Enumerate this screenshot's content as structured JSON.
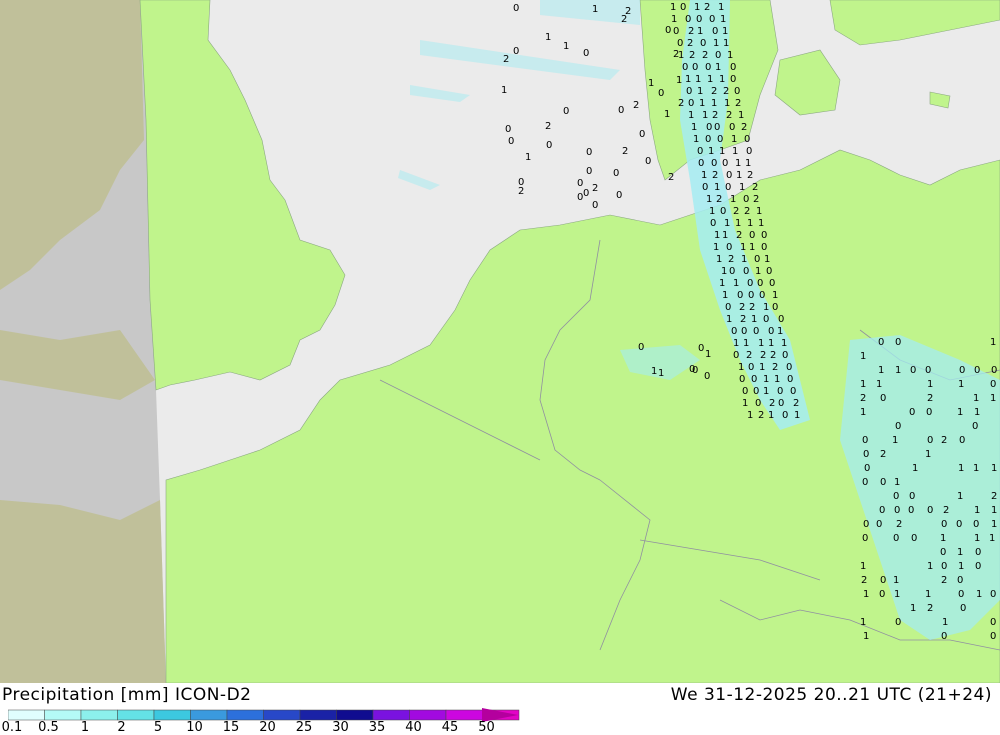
{
  "title": "Precipitation [mm] ICON-D2",
  "timestamp": "We 31-12-2025 20..21 UTC (21+24)",
  "legend": {
    "ticks": [
      "0.1",
      "0.5",
      "1",
      "2",
      "5",
      "10",
      "15",
      "20",
      "25",
      "30",
      "35",
      "40",
      "45",
      "50"
    ],
    "colors": [
      "#e0fefe",
      "#b4faf6",
      "#8cf0ec",
      "#64e2e6",
      "#3cc8e0",
      "#3a9ade",
      "#2c70dc",
      "#2848c8",
      "#1a22a6",
      "#100c90",
      "#7a12e0",
      "#a20ae0",
      "#cc06e0",
      "#e204c6",
      "#b4009e"
    ]
  },
  "colors": {
    "land": "#c0f48c",
    "sea": "#ebebeb",
    "outside_domain": "#c8c8c8",
    "outside_land": "#c0c09a",
    "light_precip": "#a4ecf2"
  },
  "precip_labels": [
    "0",
    "0",
    "1",
    "1",
    "0",
    "1",
    "2"
  ]
}
